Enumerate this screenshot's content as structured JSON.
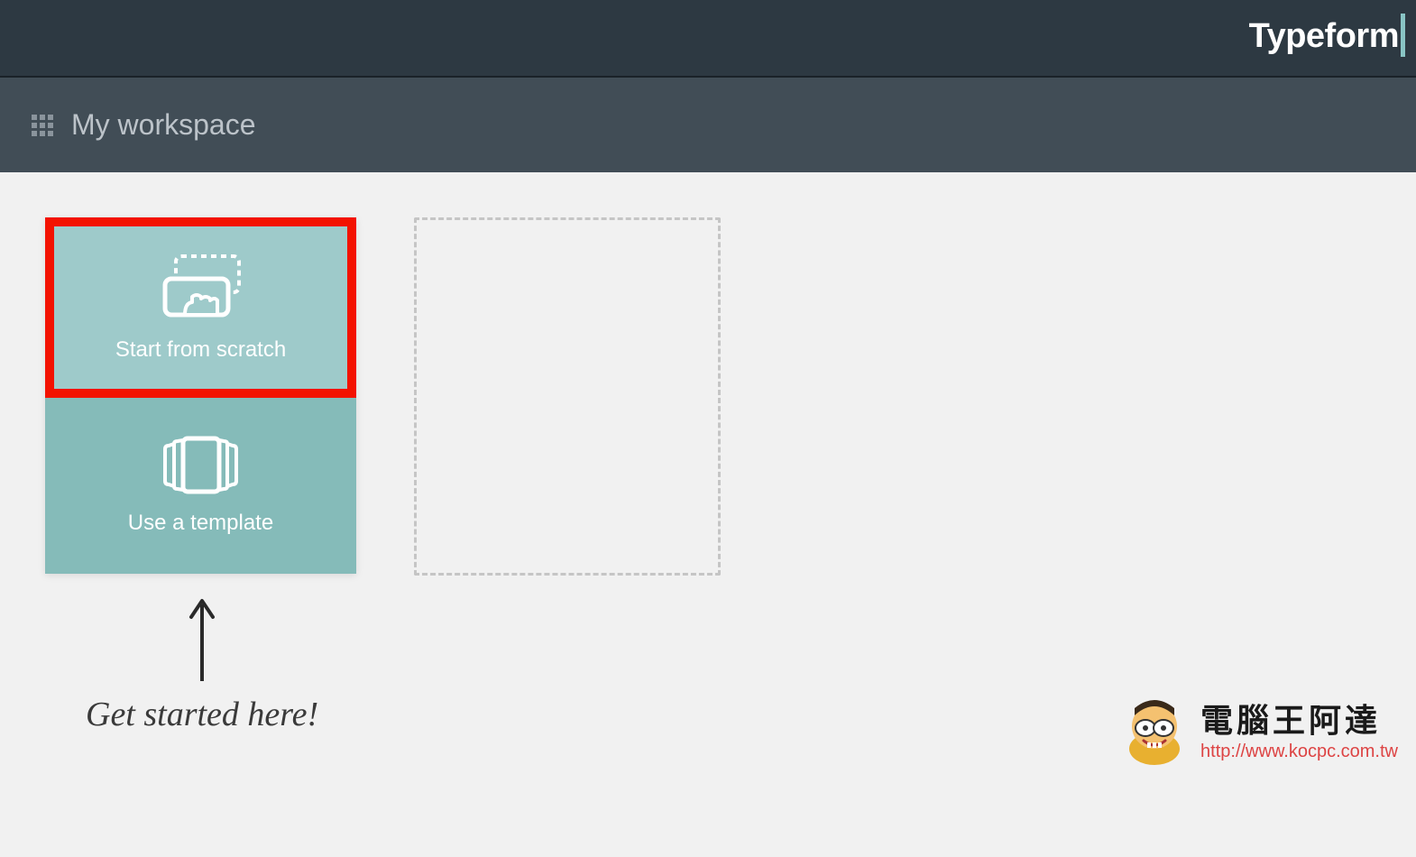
{
  "header": {
    "brand": "Typeform"
  },
  "subheader": {
    "workspace_title": "My workspace"
  },
  "cards": {
    "scratch_label": "Start from scratch",
    "template_label": "Use a template"
  },
  "annotation": {
    "text": "Get started here!"
  },
  "watermark": {
    "title": "電腦王阿達",
    "url": "http://www.kocpc.com.tw"
  }
}
